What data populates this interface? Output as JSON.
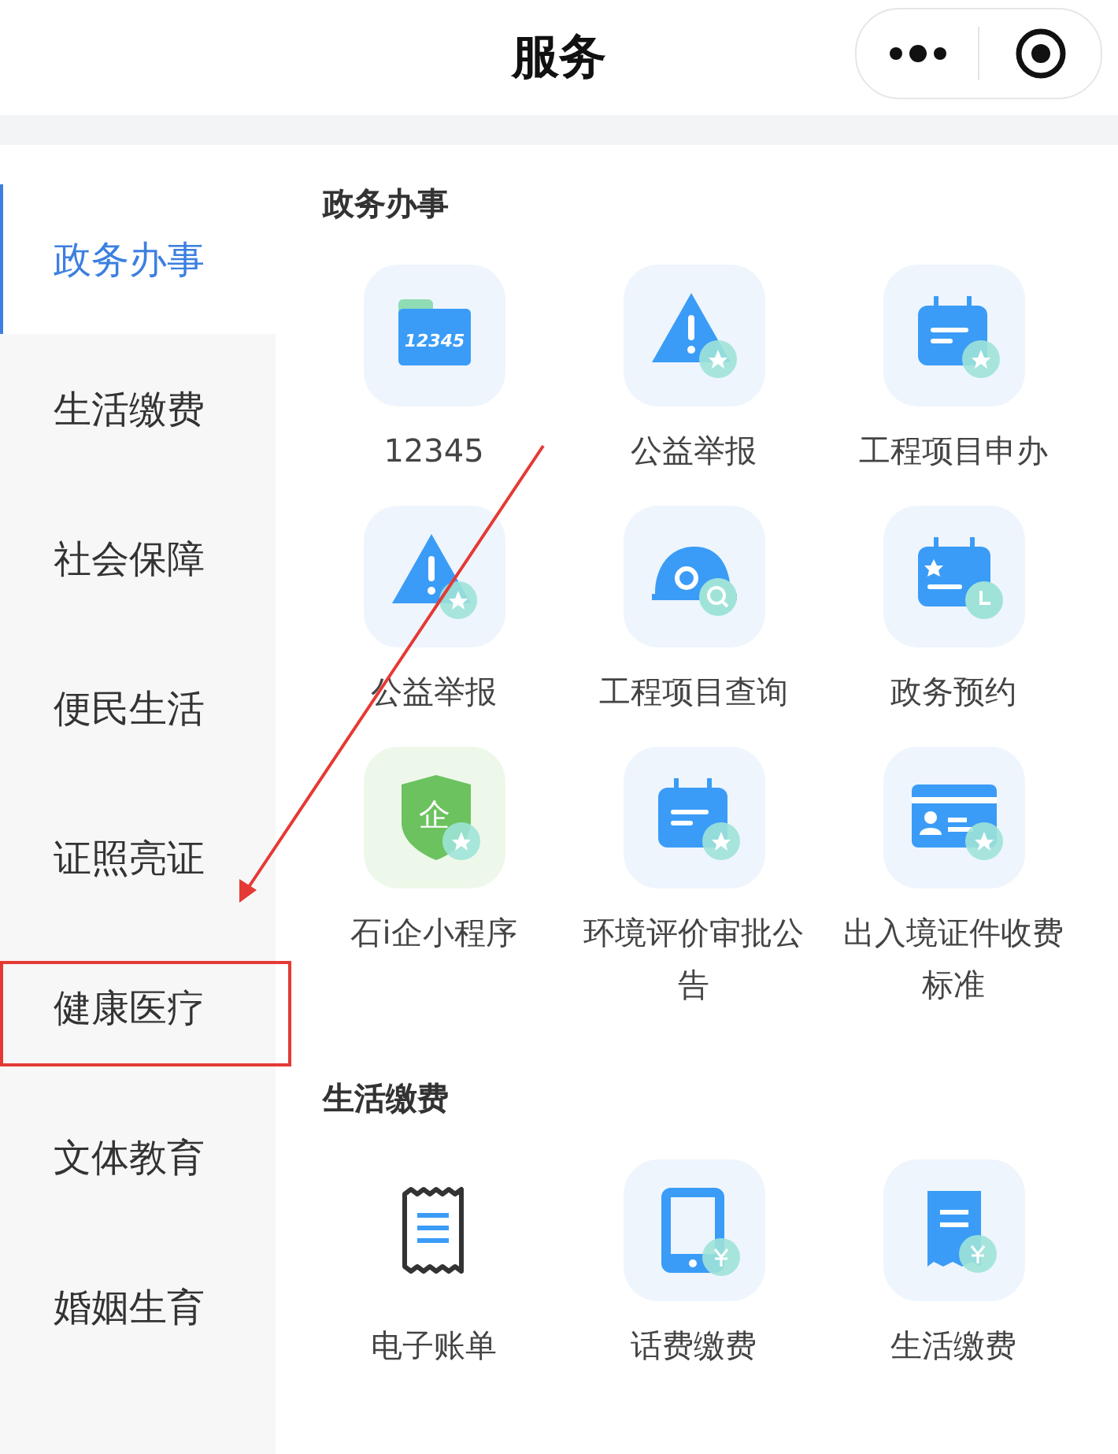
{
  "header": {
    "title": "服务"
  },
  "sidebar": {
    "items": [
      {
        "label": "政务办事",
        "selected": true
      },
      {
        "label": "生活缴费",
        "selected": false
      },
      {
        "label": "社会保障",
        "selected": false
      },
      {
        "label": "便民生活",
        "selected": false
      },
      {
        "label": "证照亮证",
        "selected": false
      },
      {
        "label": "健康医疗",
        "selected": false,
        "highlighted": true
      },
      {
        "label": "文体教育",
        "selected": false
      },
      {
        "label": "婚姻生育",
        "selected": false
      }
    ]
  },
  "sections": [
    {
      "title": "政务办事",
      "services": [
        {
          "label": "12345",
          "kind": "folder",
          "icon_text": "12345"
        },
        {
          "label": "公益举报",
          "kind": "warning"
        },
        {
          "label": "工程项目申办",
          "kind": "calendar"
        },
        {
          "label": "公益举报",
          "kind": "warning"
        },
        {
          "label": "工程项目查询",
          "kind": "helmet"
        },
        {
          "label": "政务预约",
          "kind": "calendar-star"
        },
        {
          "label": "石i企小程序",
          "kind": "shield",
          "icon_text": "企"
        },
        {
          "label": "环境评价审批公告",
          "kind": "calendar"
        },
        {
          "label": "出入境证件收费标准",
          "kind": "card"
        }
      ]
    },
    {
      "title": "生活缴费",
      "services": [
        {
          "label": "电子账单",
          "kind": "receipt"
        },
        {
          "label": "话费缴费",
          "kind": "phone"
        },
        {
          "label": "生活缴费",
          "kind": "bill"
        }
      ]
    }
  ],
  "annotation": {
    "arrow": true
  }
}
